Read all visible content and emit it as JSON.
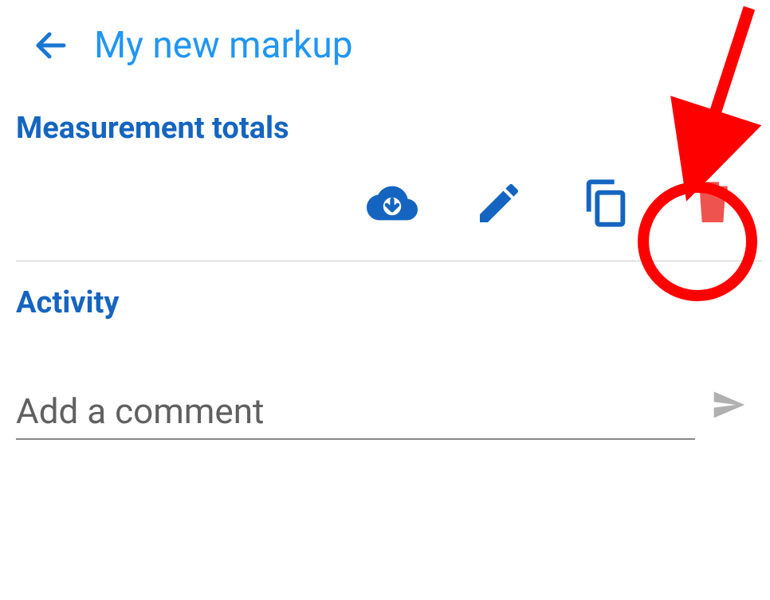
{
  "header": {
    "title": "My new markup"
  },
  "sections": {
    "measurement": {
      "title": "Measurement totals"
    },
    "activity": {
      "title": "Activity"
    }
  },
  "comment": {
    "placeholder": "Add a comment"
  },
  "icons": {
    "back": "back-arrow",
    "chevron": "chevron-down",
    "download": "cloud-download",
    "edit": "pencil",
    "copy": "copy",
    "delete": "trash",
    "send": "send"
  },
  "annotation": {
    "target": "delete-button",
    "circle_color": "#ff0000",
    "arrow_color": "#ff0000"
  }
}
